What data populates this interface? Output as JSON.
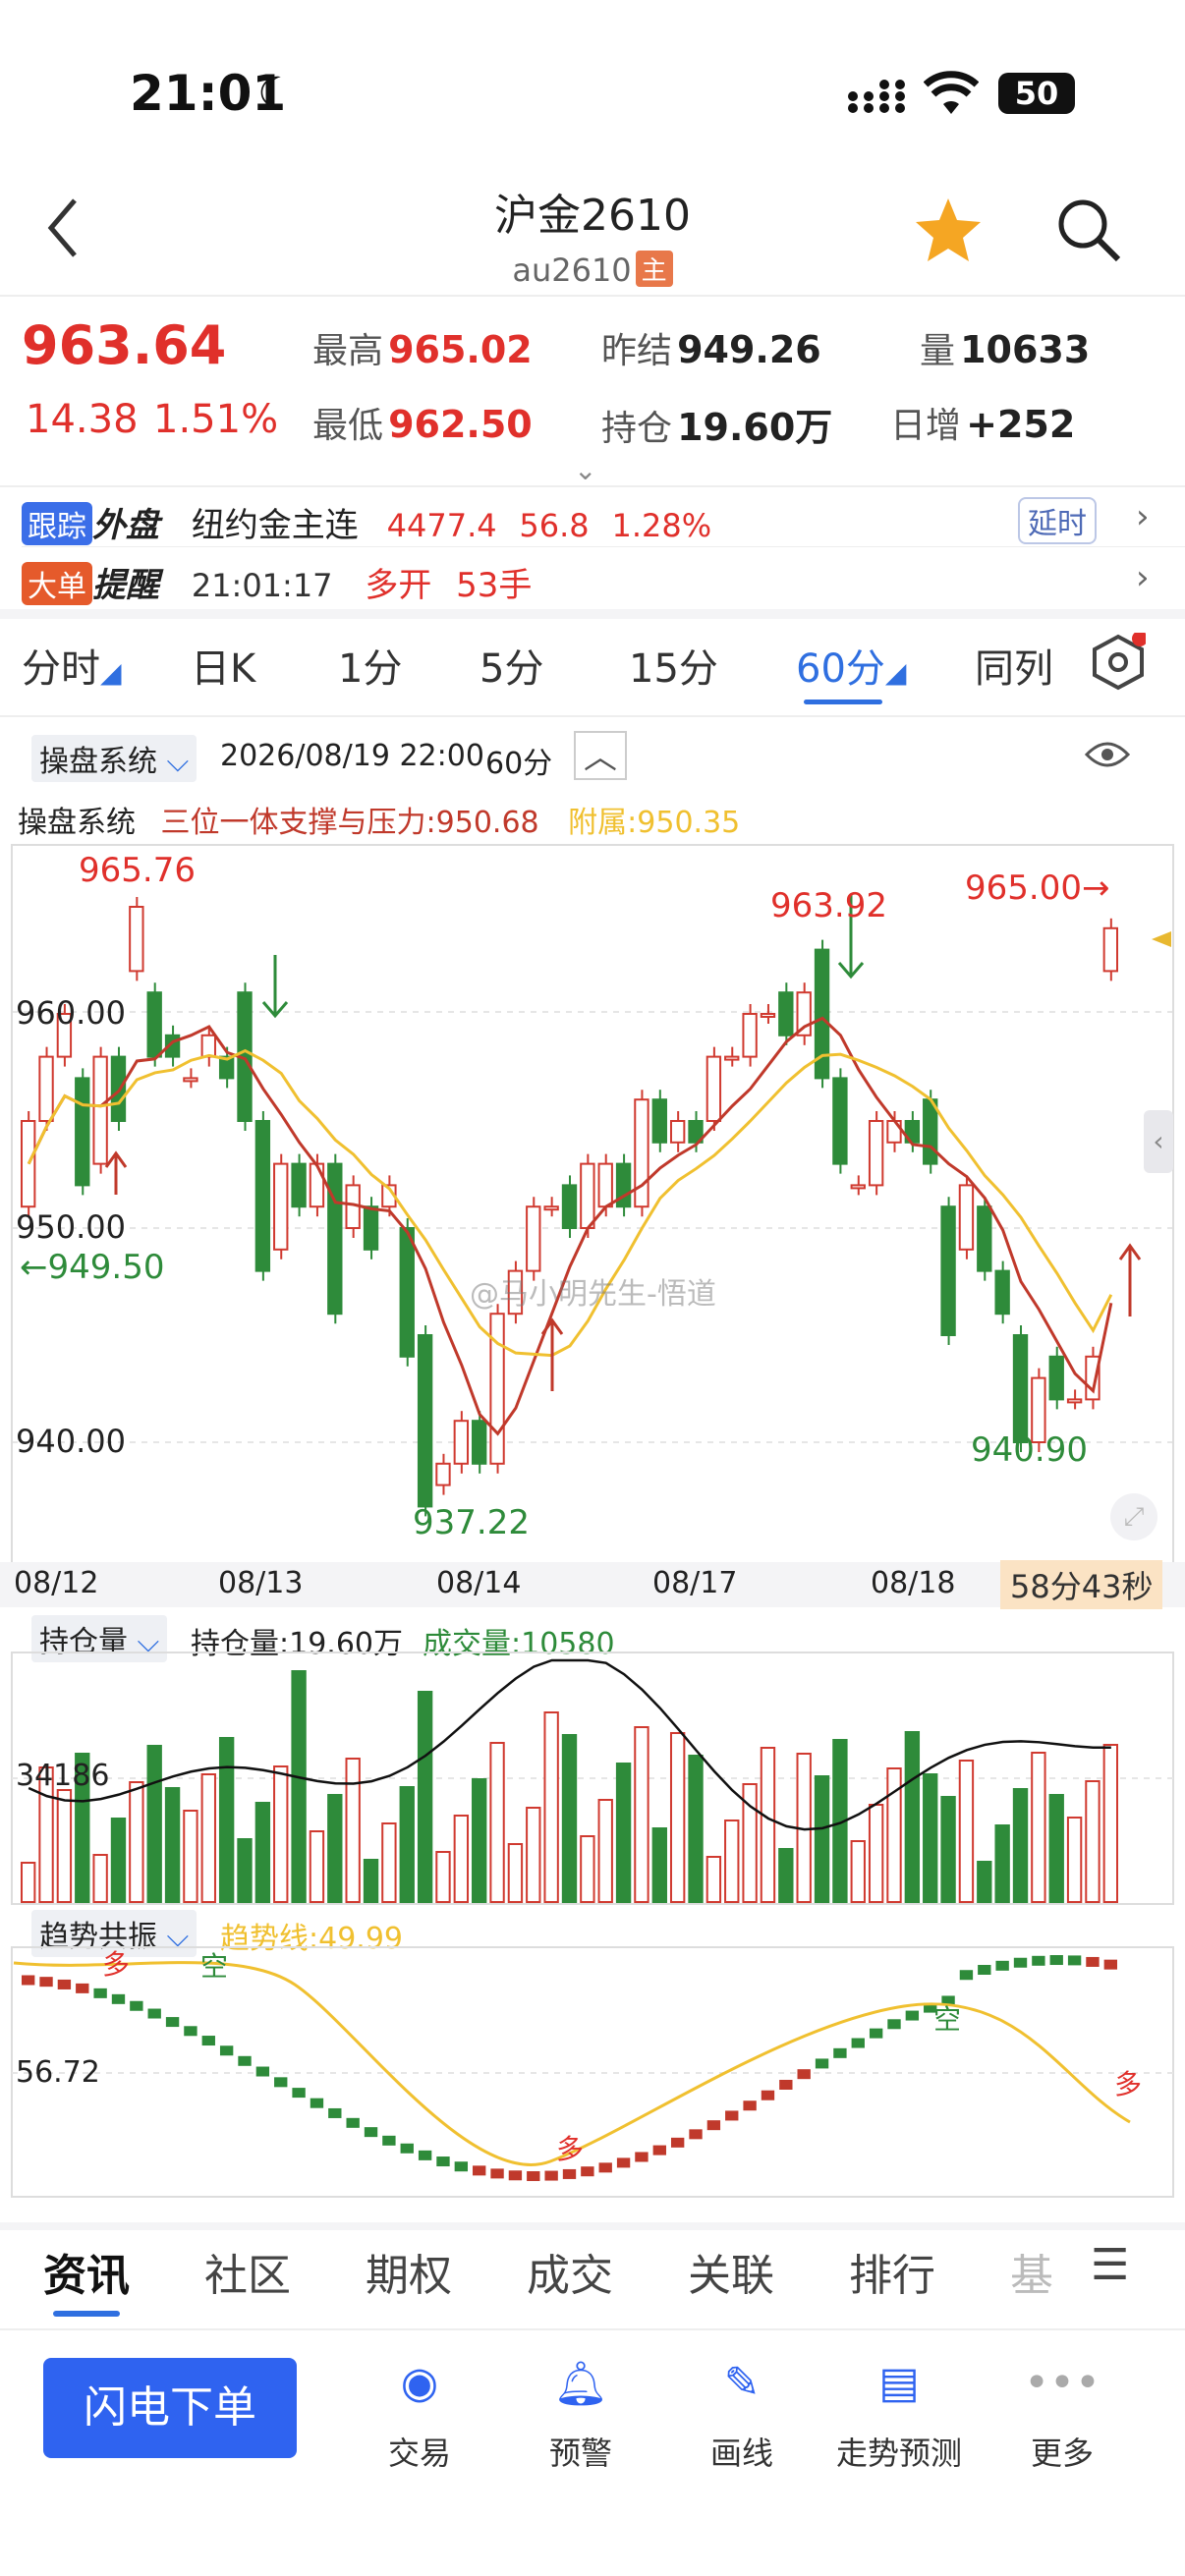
{
  "status": {
    "time": "21:01",
    "battery": "50"
  },
  "nav": {
    "title": "沪金2610",
    "subtitle": "au2610",
    "badge": "主"
  },
  "quote": {
    "price": "963.64",
    "change": "14.38",
    "pct": "1.51%",
    "high_label": "最高",
    "high": "965.02",
    "low_label": "最低",
    "low": "962.50",
    "settle_label": "昨结",
    "settle": "949.26",
    "oi_label": "持仓",
    "oi": "19.60万",
    "vol_label": "量",
    "vol": "10633",
    "daily_label": "日增",
    "daily": "+252"
  },
  "track": {
    "tag1": "跟踪",
    "tag2": "外盘",
    "name": "纽约金主连",
    "price": "4477.4",
    "chg": "56.8",
    "pct": "1.28%",
    "delay": "延时"
  },
  "alert": {
    "tag1": "大单",
    "tag2": "提醒",
    "time": "21:01:17",
    "action": "多开",
    "qty": "53手"
  },
  "tabs": [
    {
      "label": "分时"
    },
    {
      "label": "日K"
    },
    {
      "label": "1分"
    },
    {
      "label": "5分"
    },
    {
      "label": "15分"
    },
    {
      "label": "60分"
    },
    {
      "label": "同列"
    }
  ],
  "chart_header": {
    "system": "操盘系统",
    "datetime": "2026/08/19 22:00",
    "period": "60分"
  },
  "indicator": {
    "name": "操盘系统",
    "support": "三位一体支撑与压力:950.68",
    "aux": "附属:950.35"
  },
  "price_labels": {
    "y960": "960.00",
    "y950": "950.00",
    "y940": "940.00",
    "hi1": "965.76",
    "lo1": "937.22",
    "hi2": "963.92",
    "lo2": "940.90",
    "right": "965.00→",
    "left": "←949.50"
  },
  "watermark": "@马小明先生-悟道",
  "dates": [
    "08/12",
    "08/13",
    "08/14",
    "08/17",
    "08/18"
  ],
  "countdown": "58分43秒",
  "oi_panel": {
    "name": "持仓量",
    "oi": "持仓量:19.60万",
    "vol": "成交量:10580",
    "tick": "34186"
  },
  "trend_panel": {
    "name": "趋势共振",
    "line": "趋势线:49.99",
    "tick": "56.72",
    "m1": "多",
    "m2": "空",
    "m3": "多",
    "m4": "空",
    "m5": "多"
  },
  "bottom_tabs": [
    {
      "label": "资讯"
    },
    {
      "label": "社区"
    },
    {
      "label": "期权"
    },
    {
      "label": "成交"
    },
    {
      "label": "关联"
    },
    {
      "label": "排行"
    },
    {
      "label": "基"
    }
  ],
  "dock": {
    "quick": "闪电下单",
    "items": [
      {
        "label": "交易"
      },
      {
        "label": "预警"
      },
      {
        "label": "画线"
      },
      {
        "label": "走势预测"
      },
      {
        "label": "更多"
      }
    ]
  },
  "chart_data": {
    "type": "candlestick",
    "x_labels": [
      "08/12",
      "08/13",
      "08/14",
      "08/17",
      "08/18"
    ],
    "annotations": [
      "965.76",
      "937.22",
      "963.92",
      "940.90",
      "965.00",
      "949.50"
    ],
    "y_ticks": [
      960.0,
      950.0,
      940.0
    ],
    "candles": [
      [
        951,
        955
      ],
      [
        955,
        958
      ],
      [
        958,
        960
      ],
      [
        957,
        952
      ],
      [
        953,
        958
      ],
      [
        958,
        955
      ],
      [
        962,
        965
      ],
      [
        961,
        958
      ],
      [
        959,
        958
      ],
      [
        957,
        957
      ],
      [
        958,
        959
      ],
      [
        958,
        957
      ],
      [
        961,
        955
      ],
      [
        955,
        948
      ],
      [
        949,
        953
      ],
      [
        953,
        951
      ],
      [
        951,
        953
      ],
      [
        953,
        946
      ],
      [
        950,
        952
      ],
      [
        951,
        949
      ],
      [
        951,
        952
      ],
      [
        950,
        944
      ],
      [
        945,
        937
      ],
      [
        938,
        939
      ],
      [
        939,
        941
      ],
      [
        941,
        939
      ],
      [
        939,
        946
      ],
      [
        946,
        948
      ],
      [
        948,
        951
      ],
      [
        951,
        951
      ],
      [
        952,
        950
      ],
      [
        950,
        953
      ],
      [
        951,
        953
      ],
      [
        953,
        951
      ],
      [
        951,
        956
      ],
      [
        956,
        954
      ],
      [
        954,
        955
      ],
      [
        955,
        954
      ],
      [
        955,
        958
      ],
      [
        958,
        958
      ],
      [
        958,
        960
      ],
      [
        960,
        960
      ],
      [
        961,
        959
      ],
      [
        959,
        961
      ],
      [
        963,
        957
      ],
      [
        957,
        953
      ],
      [
        952,
        952
      ],
      [
        952,
        955
      ],
      [
        954,
        955
      ],
      [
        955,
        954
      ],
      [
        956,
        953
      ],
      [
        951,
        945
      ],
      [
        949,
        952
      ],
      [
        951,
        948
      ],
      [
        948,
        946
      ],
      [
        945,
        940
      ],
      [
        940,
        943
      ],
      [
        944,
        942
      ],
      [
        942,
        942
      ],
      [
        942,
        944
      ],
      [
        962,
        964
      ]
    ]
  }
}
